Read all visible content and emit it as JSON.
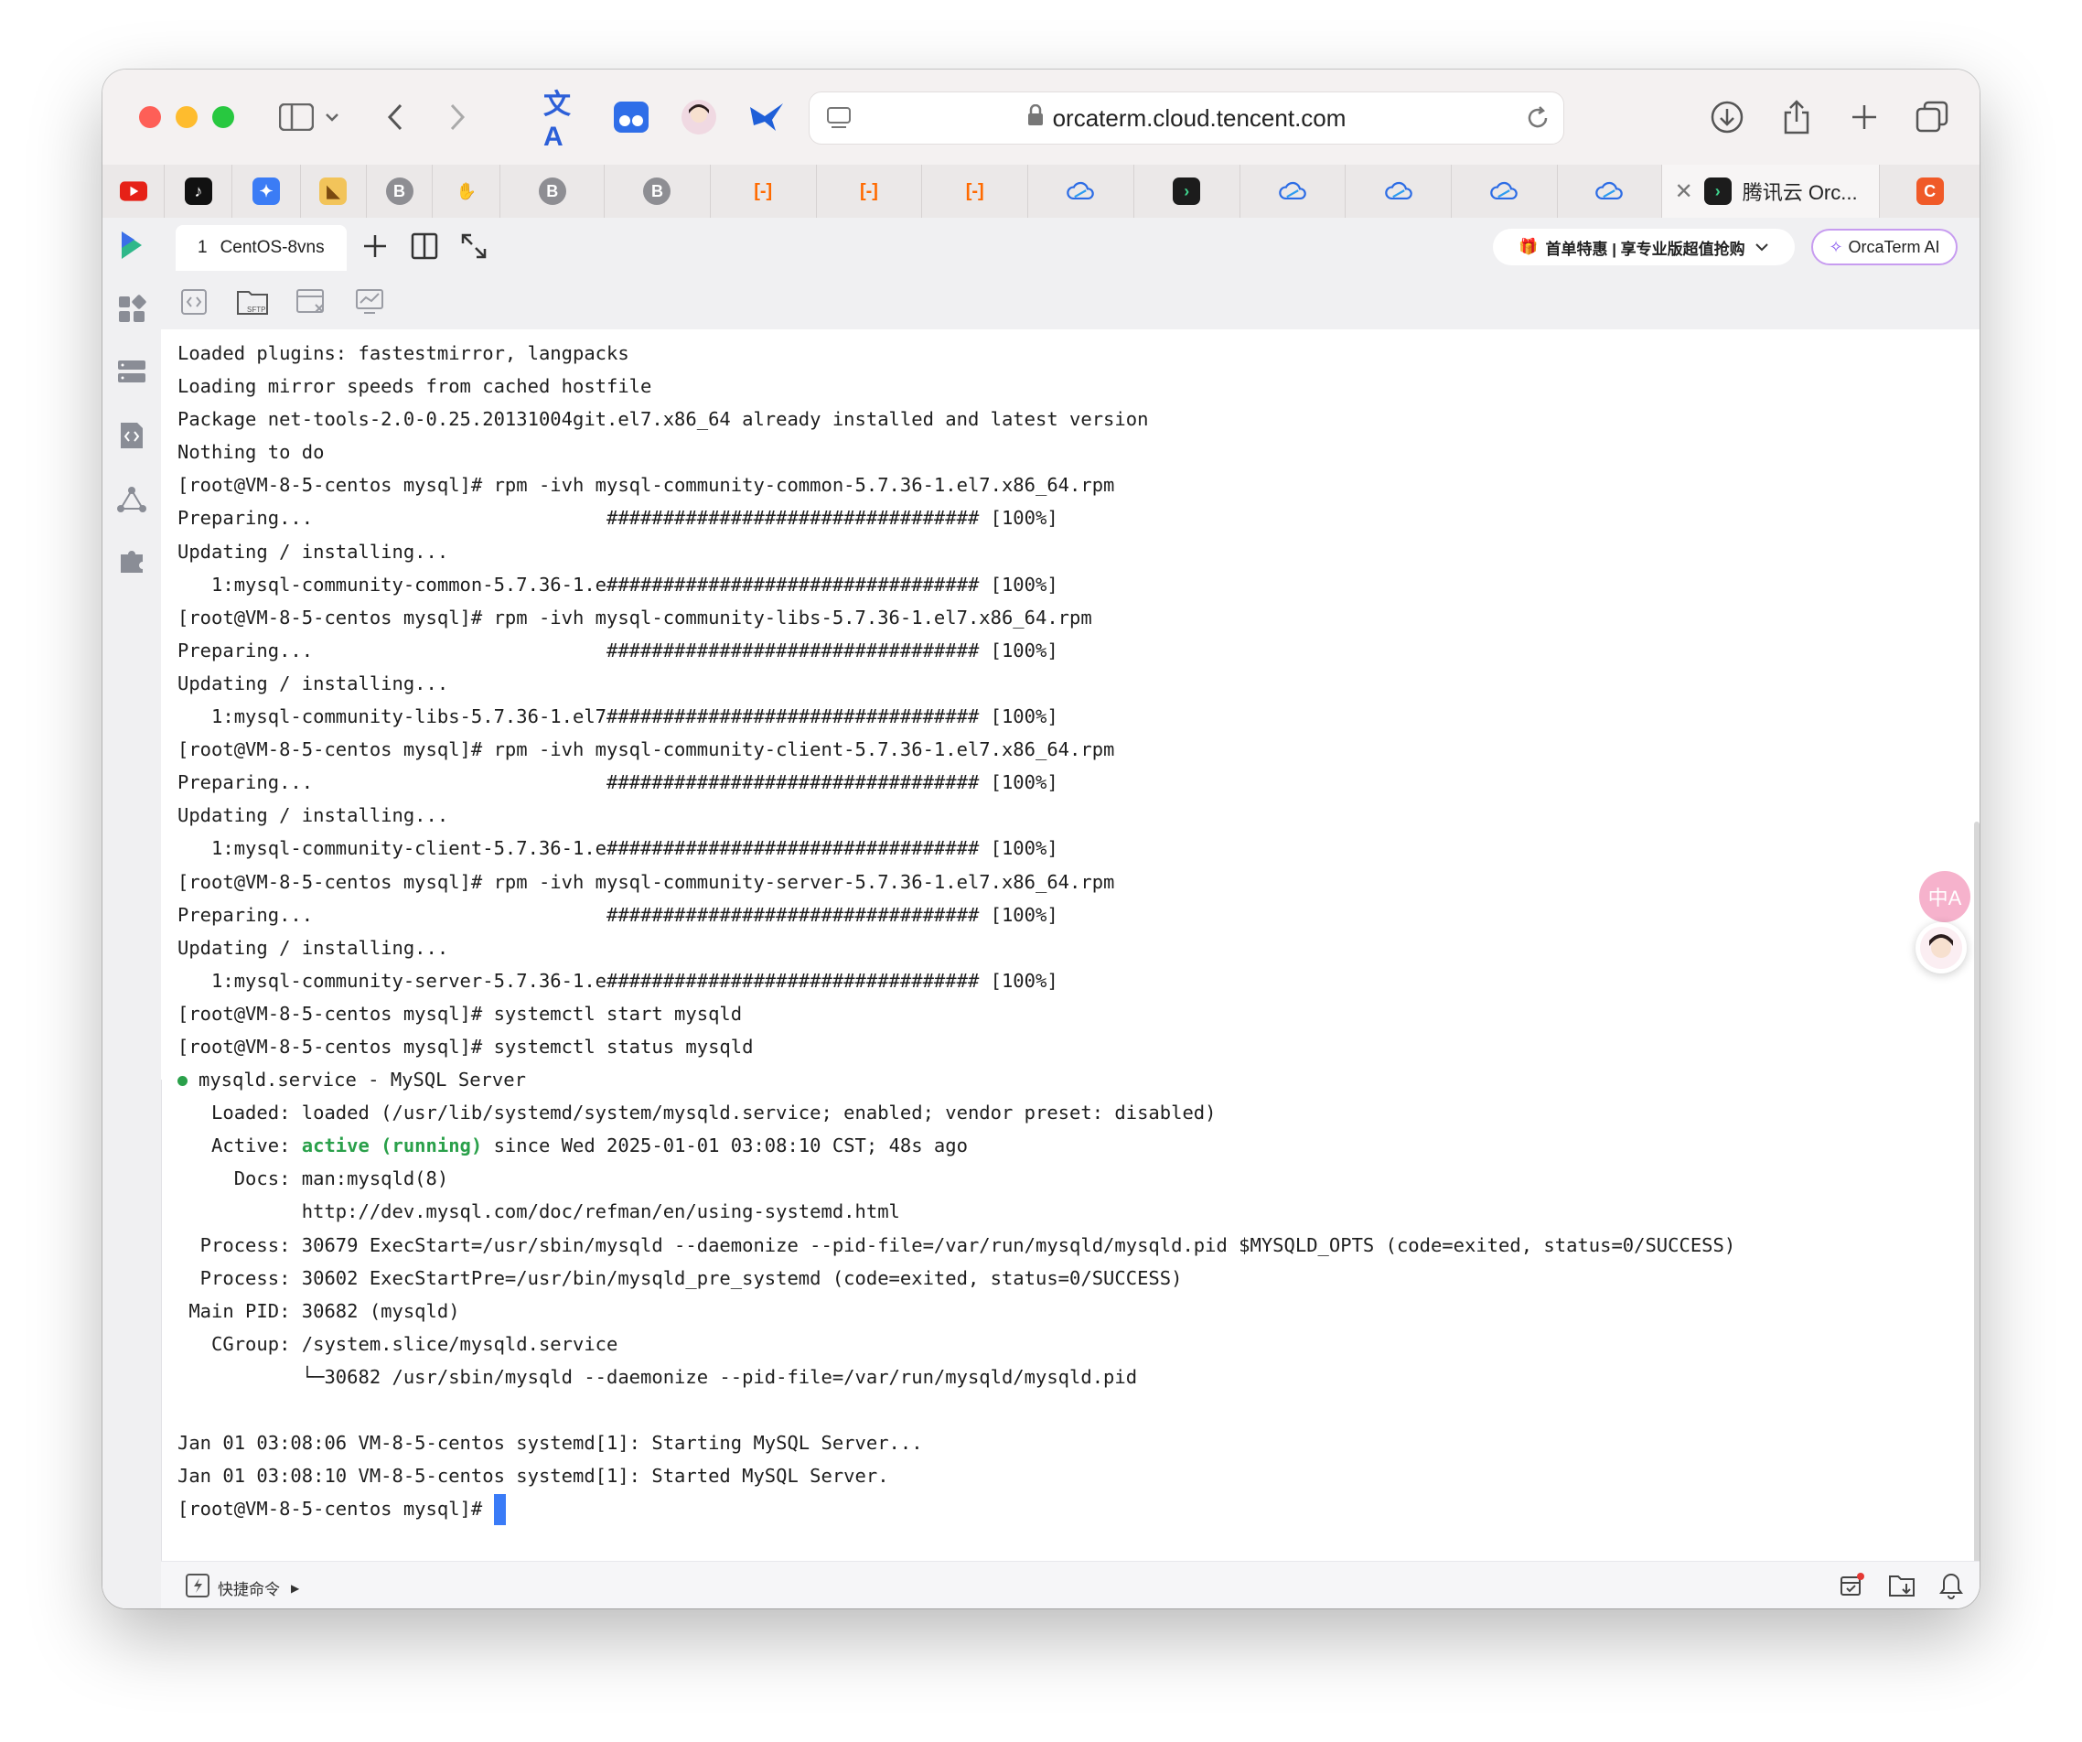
{
  "browser": {
    "url": "orcaterm.cloud.tencent.com",
    "tabs": [
      {
        "icon": "youtube-icon",
        "color": "#e62117",
        "glyph": "▶"
      },
      {
        "icon": "tiktok-icon",
        "color": "#111111",
        "glyph": "♪"
      },
      {
        "icon": "app-icon",
        "color": "#3b7cf5",
        "glyph": "✦"
      },
      {
        "icon": "pizza-icon",
        "color": "#f2c45a",
        "glyph": "◣"
      },
      {
        "icon": "b-icon",
        "color": "#8e8e93",
        "glyph": "B"
      },
      {
        "icon": "hand-icon",
        "color": "#b0b0b0",
        "glyph": "✋"
      },
      {
        "icon": "b-icon",
        "color": "#8e8e93",
        "glyph": "B"
      },
      {
        "icon": "b-icon",
        "color": "#8e8e93",
        "glyph": "B"
      },
      {
        "icon": "aliyun-icon",
        "color": "#ff6a00",
        "glyph": "[-]"
      },
      {
        "icon": "aliyun-icon",
        "color": "#ff6a00",
        "glyph": "[-]"
      },
      {
        "icon": "aliyun-icon",
        "color": "#ff6a00",
        "glyph": "[-]"
      },
      {
        "icon": "tencent-cloud-icon",
        "color": "#2c6ce5",
        "glyph": "☁"
      },
      {
        "icon": "orcaterm-icon",
        "color": "#1c1c1c",
        "glyph": "›"
      },
      {
        "icon": "tencent-cloud-icon",
        "color": "#2c6ce5",
        "glyph": "☁"
      },
      {
        "icon": "tencent-cloud-icon",
        "color": "#2c6ce5",
        "glyph": "☁"
      },
      {
        "icon": "tencent-cloud-icon",
        "color": "#2c6ce5",
        "glyph": "☁"
      },
      {
        "icon": "tencent-cloud-icon",
        "color": "#2c6ce5",
        "glyph": "☁"
      }
    ],
    "active_tab": {
      "title": "腾讯云 Orc..."
    },
    "last_tab": {
      "glyph": "C",
      "color": "#f05a28"
    }
  },
  "app": {
    "session_tab": {
      "index": "1",
      "name": "CentOS-8vns"
    },
    "promo": "首单特惠 | 享专业版超值抢购",
    "ai_button": "OrcaTerm AI",
    "footer": {
      "quick_commands": "快捷命令"
    },
    "float_translate": "中A"
  },
  "terminal": {
    "lines": [
      "Loaded plugins: fastestmirror, langpacks",
      "Loading mirror speeds from cached hostfile",
      "Package net-tools-2.0-0.25.20131004git.el7.x86_64 already installed and latest version",
      "Nothing to do",
      "[root@VM-8-5-centos mysql]# rpm -ivh mysql-community-common-5.7.36-1.el7.x86_64.rpm",
      "Preparing...                          ################################# [100%]",
      "Updating / installing...",
      "   1:mysql-community-common-5.7.36-1.e################################# [100%]",
      "[root@VM-8-5-centos mysql]# rpm -ivh mysql-community-libs-5.7.36-1.el7.x86_64.rpm",
      "Preparing...                          ################################# [100%]",
      "Updating / installing...",
      "   1:mysql-community-libs-5.7.36-1.el7################################# [100%]",
      "[root@VM-8-5-centos mysql]# rpm -ivh mysql-community-client-5.7.36-1.el7.x86_64.rpm",
      "Preparing...                          ################################# [100%]",
      "Updating / installing...",
      "   1:mysql-community-client-5.7.36-1.e################################# [100%]",
      "[root@VM-8-5-centos mysql]# rpm -ivh mysql-community-server-5.7.36-1.el7.x86_64.rpm",
      "Preparing...                          ################################# [100%]",
      "Updating / installing...",
      "   1:mysql-community-server-5.7.36-1.e################################# [100%]",
      "[root@VM-8-5-centos mysql]# systemctl start mysqld",
      "[root@VM-8-5-centos mysql]# systemctl status mysqld"
    ],
    "service_line": "mysqld.service - MySQL Server",
    "loaded_line": "   Loaded: loaded (/usr/lib/systemd/system/mysqld.service; enabled; vendor preset: disabled)",
    "active_prefix": "   Active: ",
    "active_status": "active (running)",
    "active_suffix": " since Wed 2025-01-01 03:08:10 CST; 48s ago",
    "lines2": [
      "     Docs: man:mysqld(8)",
      "           http://dev.mysql.com/doc/refman/en/using-systemd.html",
      "  Process: 30679 ExecStart=/usr/sbin/mysqld --daemonize --pid-file=/var/run/mysqld/mysqld.pid $MYSQLD_OPTS (code=exited, status=0/SUCCESS)",
      "  Process: 30602 ExecStartPre=/usr/bin/mysqld_pre_systemd (code=exited, status=0/SUCCESS)",
      " Main PID: 30682 (mysqld)",
      "   CGroup: /system.slice/mysqld.service",
      "           └─30682 /usr/sbin/mysqld --daemonize --pid-file=/var/run/mysqld/mysqld.pid",
      "",
      "Jan 01 03:08:06 VM-8-5-centos systemd[1]: Starting MySQL Server...",
      "Jan 01 03:08:10 VM-8-5-centos systemd[1]: Started MySQL Server."
    ],
    "prompt": "[root@VM-8-5-centos mysql]# "
  }
}
